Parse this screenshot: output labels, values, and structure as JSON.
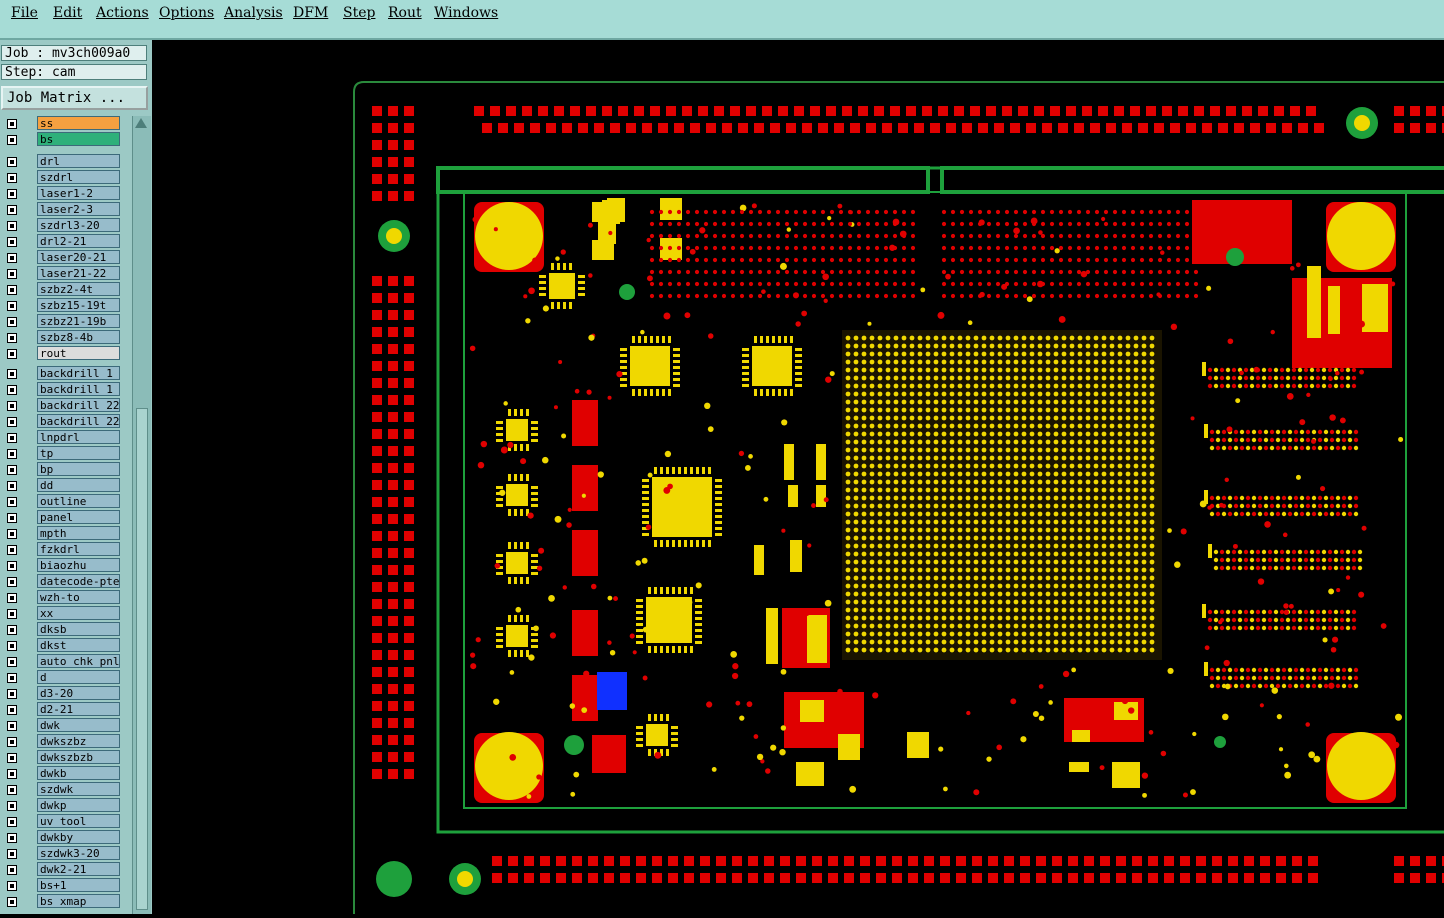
{
  "menu": [
    "File",
    "Edit",
    "Actions",
    "Options",
    "Analysis",
    "DFM",
    "Step",
    "Rout",
    "Windows"
  ],
  "job_label": "Job : mv3ch009a0",
  "step_label": "Step: cam",
  "job_matrix_button": "Job Matrix ...",
  "active_layers": [
    {
      "name": "ss",
      "color": "#f5a040"
    },
    {
      "name": "bs",
      "color": "#2eb07a"
    }
  ],
  "layers_group1": [
    "drl",
    "szdrl",
    "laser1-2",
    "laser2-3",
    "szdrl3-20",
    "drl2-21",
    "laser20-21",
    "laser21-22",
    "szbz2-4t",
    "szbz15-19t",
    "szbz21-19b",
    "szbz8-4b",
    "rout"
  ],
  "layers_group2": [
    "backdrill_1_",
    "backdrill_1_",
    "backdrill_22",
    "backdrill_22",
    "lnpdrl",
    "tp",
    "bp",
    "dd",
    "outline",
    "panel",
    "mpth",
    "fzkdrl",
    "biaozhu",
    "datecode-pte",
    "wzh-to",
    "xx",
    "dksb",
    "dkst",
    "auto_chk_pnl",
    "d",
    "d3-20",
    "d2-21",
    "dwk",
    "dwkszbz",
    "dwkszbzb",
    "dwkb",
    "szdwk",
    "dwkp",
    "uv_tool",
    "dwkby",
    "szdwk3-20",
    "dwk2-21",
    "bs+1",
    "bs_xmap"
  ],
  "colors": {
    "board_outline": "#1ea03c",
    "copper": "#f0d800",
    "solder_mask": "#e00000",
    "highlight": "#1030ff"
  }
}
